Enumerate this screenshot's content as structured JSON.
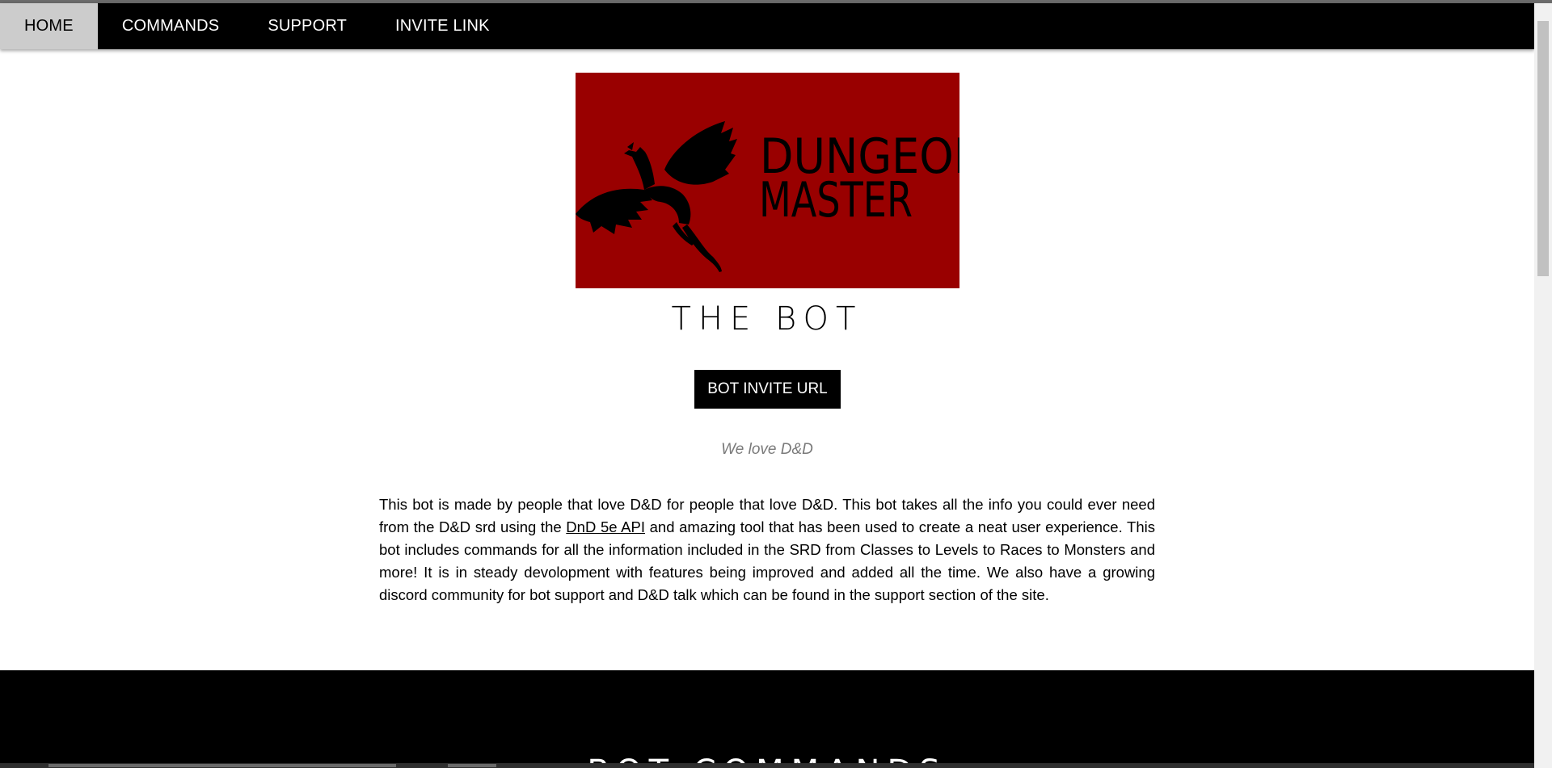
{
  "nav": {
    "items": [
      {
        "label": "HOME",
        "active": true
      },
      {
        "label": "COMMANDS",
        "active": false
      },
      {
        "label": "SUPPORT",
        "active": false
      },
      {
        "label": "INVITE LINK",
        "active": false
      }
    ]
  },
  "hero": {
    "logo": {
      "line1": "DUNGEON",
      "line2": "MASTER",
      "background": "#990000",
      "icon": "dragon-icon"
    },
    "title": "THE BOT",
    "invite_button": "BOT INVITE URL",
    "tagline": "We love D&D"
  },
  "about": {
    "text_before": "This bot is made by people that love D&D for people that love D&D. This bot takes all the info you could ever need from the D&D srd using the ",
    "link": "DnD 5e API",
    "text_after": " and amazing tool that has been used to create a neat user experience. This bot includes commands for all the information included in the SRD from Classes to Levels to Races to Monsters and more! It is in steady devolopment with features being improved and added all the time. We also have a growing discord community for bot support and D&D talk which can be found in the support section of the site."
  },
  "commands_section": {
    "heading": "BOT COMMANDS"
  },
  "colors": {
    "nav_bg": "#000000",
    "nav_active_bg": "#cccccc",
    "logo_bg": "#990000",
    "button_bg": "#000000"
  }
}
